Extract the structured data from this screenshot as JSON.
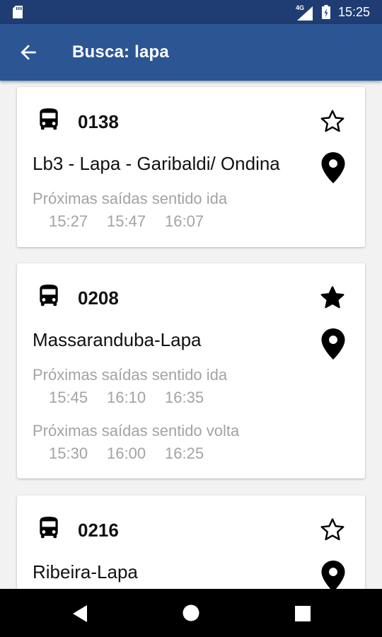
{
  "status_bar": {
    "network": "4G",
    "time": "15:25"
  },
  "header": {
    "title": "Busca: lapa"
  },
  "routes": [
    {
      "number": "0138",
      "name": "Lb3 - Lapa - Garibaldi/ Ondina",
      "favorite": false,
      "ida_label": "Próximas saídas sentido ida",
      "ida_times": [
        "15:27",
        "15:47",
        "16:07"
      ]
    },
    {
      "number": "0208",
      "name": "Massaranduba-Lapa",
      "favorite": true,
      "ida_label": "Próximas saídas sentido ida",
      "ida_times": [
        "15:45",
        "16:10",
        "16:35"
      ],
      "volta_label": "Próximas saídas sentido volta",
      "volta_times": [
        "15:30",
        "16:00",
        "16:25"
      ]
    },
    {
      "number": "0216",
      "name": "Ribeira-Lapa",
      "favorite": false
    }
  ],
  "colors": {
    "status_bar": "#1f3d73",
    "app_bar": "#2c5594",
    "secondary_text": "#a3a3a3"
  },
  "icons": [
    "back-arrow",
    "bus",
    "star-outline",
    "star-filled",
    "map-pin",
    "nav-back",
    "nav-home",
    "nav-recents"
  ]
}
